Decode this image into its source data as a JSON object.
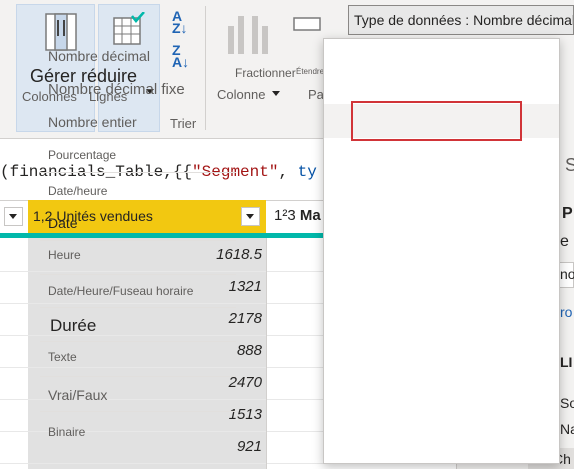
{
  "ribbon": {
    "manage_reduce": {
      "title": "Gérer réduire",
      "sub_columns": "Colonnes",
      "sub_rows": "Lignes"
    },
    "sort": {
      "label": "Trier",
      "asc_icon": "sort-az-icon",
      "desc_icon": "sort-za-icon"
    },
    "split": {
      "top": "Fractionner",
      "bottom": "Colonne",
      "tag": "Étendre"
    },
    "group_by_short": "Par",
    "data_type_button": "Type de données : Nombre décimal"
  },
  "formula": {
    "prefix": "(financials_Table,{{",
    "segment": "\"Segment\"",
    "comma": ", ",
    "type_kw": "ty"
  },
  "grid": {
    "selected_column": {
      "type_icon": "1,2",
      "label": "Unités vendues"
    },
    "next_column": {
      "type_icon": "1²3",
      "label": "Ma"
    },
    "rows": [
      "1618.5",
      "1321",
      "2178",
      "888",
      "2470",
      "1513",
      "921"
    ]
  },
  "side_pane": {
    "s": "S",
    "p": "P",
    "e": "e",
    "no": "no",
    "ro": "ro",
    "li": "LI",
    "so": "So",
    "na": "Na",
    "ch": "Ch"
  },
  "menu": {
    "items": [
      "Nombre décimal",
      "Nombre décimal fixe",
      "Nombre entier",
      "Pourcentage",
      "Date/heure",
      "Date",
      "Heure",
      "Date/Heure/Fuseau horaire",
      "Durée",
      "Texte",
      "Vrai/Faux",
      "Binaire"
    ]
  },
  "colors": {
    "accent_yellow": "#f2c811",
    "teal": "#01b8aa",
    "highlight_red": "#d13438"
  }
}
